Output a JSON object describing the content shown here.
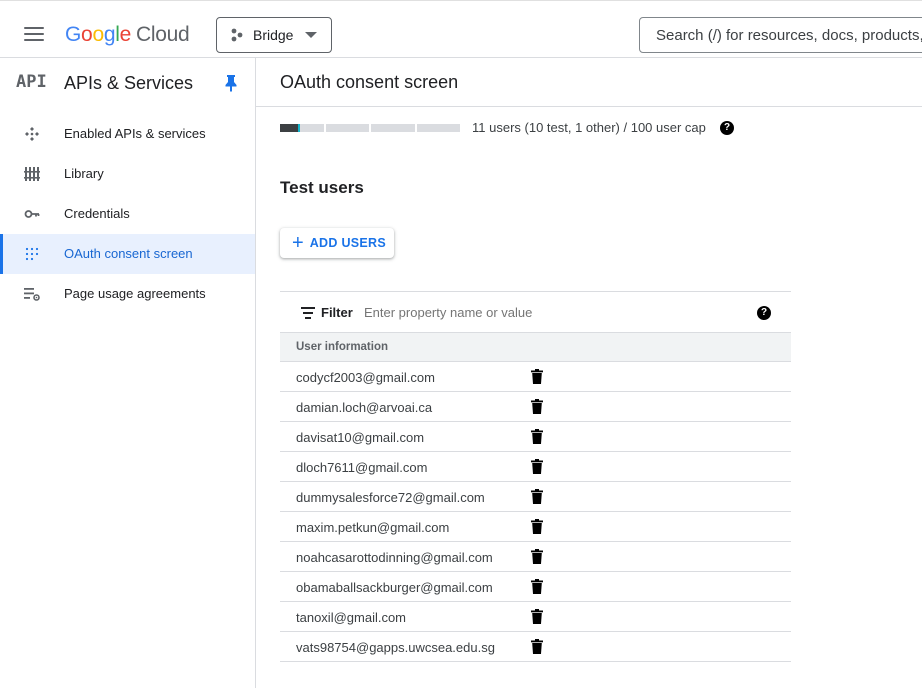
{
  "topbar": {
    "logo_letters": [
      "G",
      "o",
      "o",
      "g",
      "l",
      "e"
    ],
    "logo_product": "Cloud",
    "project_name": "Bridge",
    "search_placeholder": "Search (/) for resources, docs, products, and more"
  },
  "sidebar": {
    "section_glyph": "API",
    "section_title": "APIs & Services",
    "items": [
      {
        "label": "Enabled APIs & services",
        "icon": "enabled-apis-icon",
        "active": false
      },
      {
        "label": "Library",
        "icon": "library-icon",
        "active": false
      },
      {
        "label": "Credentials",
        "icon": "key-icon",
        "active": false
      },
      {
        "label": "OAuth consent screen",
        "icon": "oauth-icon",
        "active": true
      },
      {
        "label": "Page usage agreements",
        "icon": "settings-list-icon",
        "active": false
      }
    ]
  },
  "main": {
    "page_title": "OAuth consent screen",
    "user_cap": {
      "text": "11 users (10 test, 1 other) / 100 user cap",
      "used": 11,
      "cap": 100
    },
    "section_title": "Test users",
    "add_users_label": "ADD USERS",
    "filter": {
      "label": "Filter",
      "placeholder": "Enter property name or value"
    },
    "table": {
      "header": "User information",
      "rows": [
        "codycf2003@gmail.com",
        "damian.loch@arvoai.ca",
        "davisat10@gmail.com",
        "dloch7611@gmail.com",
        "dummysalesforce72@gmail.com",
        "maxim.petkun@gmail.com",
        "noahcasarottodinning@gmail.com",
        "obamaballsackburger@gmail.com",
        "tanoxil@gmail.com",
        "vats98754@gapps.uwcsea.edu.sg"
      ]
    }
  },
  "colors": {
    "accent": "#1a73e8",
    "active_bg": "#e8f0fe",
    "cap_fill": "#3c4043",
    "cap_tip": "#12b5cb"
  }
}
